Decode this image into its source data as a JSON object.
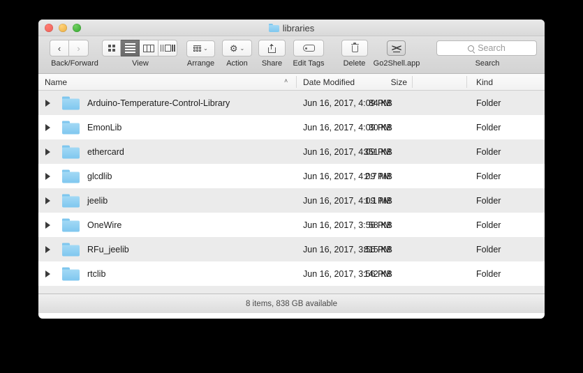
{
  "window": {
    "title": "libraries",
    "title_icon": "folder-icon",
    "traffic_lights": [
      {
        "name": "close-button",
        "color": "#ec5f56"
      },
      {
        "name": "minimize-button",
        "color": "#e9ab3c"
      },
      {
        "name": "zoom-button",
        "color": "#2fa62b"
      }
    ]
  },
  "toolbar": {
    "back_forward": {
      "label": "Back/Forward",
      "back_icon": "chevron-left-icon",
      "forward_icon": "chevron-right-icon",
      "back_glyph": "‹",
      "forward_glyph": "›",
      "forward_disabled": true
    },
    "view": {
      "label": "View",
      "modes": [
        {
          "name": "icon-view-button",
          "icon": "grid-icon",
          "selected": false
        },
        {
          "name": "list-view-button",
          "icon": "list-icon",
          "selected": true
        },
        {
          "name": "column-view-button",
          "icon": "columns-icon",
          "selected": false
        },
        {
          "name": "gallery-view-button",
          "icon": "coverflow-icon",
          "selected": false
        }
      ]
    },
    "arrange": {
      "label": "Arrange",
      "icon": "arrange-grid-icon",
      "caret": "⌄"
    },
    "action": {
      "label": "Action",
      "icon": "gear-icon",
      "glyph": "⚙",
      "caret": "⌄"
    },
    "share": {
      "label": "Share",
      "icon": "share-icon"
    },
    "edit_tags": {
      "label": "Edit Tags",
      "icon": "tag-icon"
    },
    "delete": {
      "label": "Delete",
      "icon": "trash-icon"
    },
    "go2shell": {
      "label": "Go2Shell.app",
      "icon": "terminal-icon",
      "glyph": "><"
    },
    "search": {
      "label": "Search",
      "placeholder": "Search",
      "value": "",
      "icon": "search-icon"
    }
  },
  "columns": [
    {
      "key": "name",
      "label": "Name",
      "sorted": true,
      "sort_caret": "˄"
    },
    {
      "key": "date",
      "label": "Date Modified"
    },
    {
      "key": "size",
      "label": "Size"
    },
    {
      "key": "kind",
      "label": "Kind"
    }
  ],
  "files": [
    {
      "name": "Arduino-Temperature-Control-Library",
      "date": "Jun 16, 2017, 4:09 PM",
      "size": "84 KB",
      "kind": "Folder",
      "icon": "folder-icon",
      "expandable": true
    },
    {
      "name": "EmonLib",
      "date": "Jun 16, 2017, 4:09 PM",
      "size": "30 KB",
      "kind": "Folder",
      "icon": "folder-icon",
      "expandable": true
    },
    {
      "name": "ethercard",
      "date": "Jun 16, 2017, 4:09 PM",
      "size": "351 KB",
      "kind": "Folder",
      "icon": "folder-icon",
      "expandable": true
    },
    {
      "name": "glcdlib",
      "date": "Jun 16, 2017, 4:09 PM",
      "size": "2.7 MB",
      "kind": "Folder",
      "icon": "folder-icon",
      "expandable": true
    },
    {
      "name": "jeelib",
      "date": "Jun 16, 2017, 4:09 PM",
      "size": "1.1 MB",
      "kind": "Folder",
      "icon": "folder-icon",
      "expandable": true
    },
    {
      "name": "OneWire",
      "date": "Jun 16, 2017, 3:56 PM",
      "size": "58 KB",
      "kind": "Folder",
      "icon": "folder-icon",
      "expandable": true
    },
    {
      "name": "RFu_jeelib",
      "date": "Jun 16, 2017, 3:56 PM",
      "size": "815 KB",
      "kind": "Folder",
      "icon": "folder-icon",
      "expandable": true
    },
    {
      "name": "rtclib",
      "date": "Jun 16, 2017, 3:56 PM",
      "size": "142 KB",
      "kind": "Folder",
      "icon": "folder-icon",
      "expandable": true
    }
  ],
  "status": {
    "text": "8 items, 838 GB available"
  },
  "colors": {
    "folder_blue": "#7fc7ef",
    "row_alt": "#ebebeb",
    "row_base": "#ffffff",
    "toolbar_top": "#e2e2e2",
    "toolbar_bottom": "#d3d3d3",
    "desktop": "#000000"
  }
}
